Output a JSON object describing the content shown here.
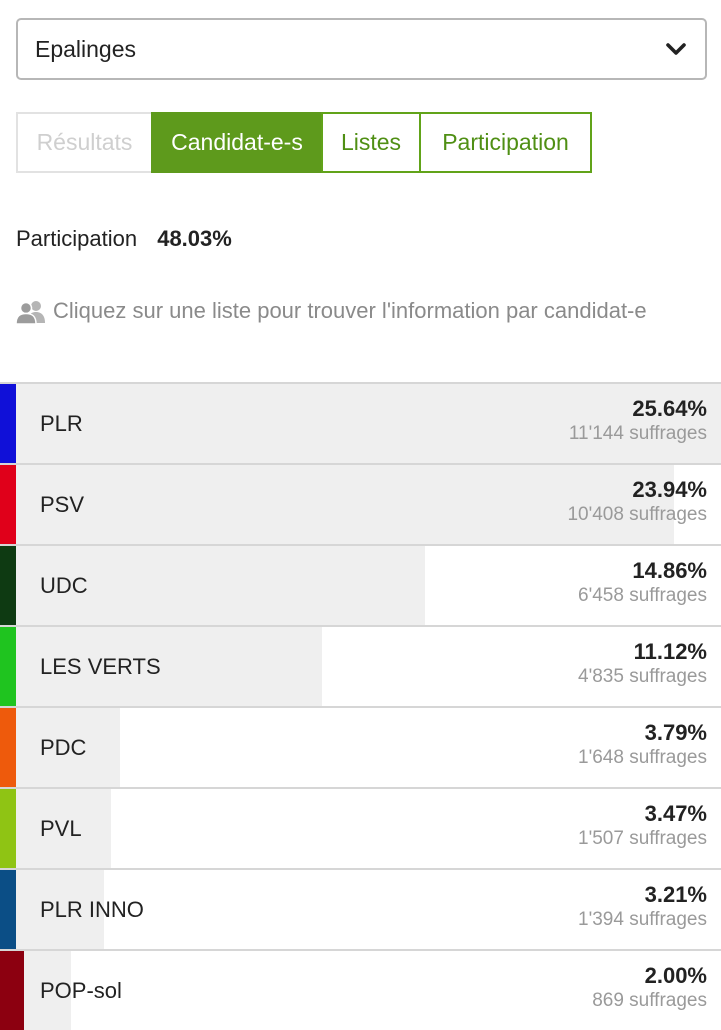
{
  "commune_select": {
    "value": "Epalinges",
    "icon": "chevron-down-icon"
  },
  "tabs": [
    {
      "label": "Résultats",
      "state": "disabled"
    },
    {
      "label": "Candidat-e-s",
      "state": "active"
    },
    {
      "label": "Listes",
      "state": "normal"
    },
    {
      "label": "Participation",
      "state": "normal"
    }
  ],
  "participation": {
    "label": "Participation",
    "value": "48.03%"
  },
  "hint": {
    "icon": "users-icon",
    "text": "Cliquez sur une liste pour trouver l'information par candidat-e"
  },
  "colors": {
    "accent": "#5e9a1c",
    "bar": "#efefef"
  },
  "lists": [
    {
      "name": "PLR",
      "percent": "25.64%",
      "votes": "11'144 suffrages",
      "share": 0.2564,
      "color": "#1010d8"
    },
    {
      "name": "PSV",
      "percent": "23.94%",
      "votes": "10'408 suffrages",
      "share": 0.2394,
      "color": "#e0001a"
    },
    {
      "name": "UDC",
      "percent": "14.86%",
      "votes": "6'458 suffrages",
      "share": 0.1486,
      "color": "#0e3a12"
    },
    {
      "name": "LES VERTS",
      "percent": "11.12%",
      "votes": "4'835 suffrages",
      "share": 0.1112,
      "color": "#1fc41f"
    },
    {
      "name": "PDC",
      "percent": "3.79%",
      "votes": "1'648 suffrages",
      "share": 0.0379,
      "color": "#ee5a0c"
    },
    {
      "name": "PVL",
      "percent": "3.47%",
      "votes": "1'507 suffrages",
      "share": 0.0347,
      "color": "#8fc414"
    },
    {
      "name": "PLR INNO",
      "percent": "3.21%",
      "votes": "1'394 suffrages",
      "share": 0.0321,
      "color": "#0b4e86"
    },
    {
      "name": "POP-sol",
      "percent": "2.00%",
      "votes": "869 suffrages",
      "share": 0.02,
      "color": "#8c0010"
    }
  ]
}
